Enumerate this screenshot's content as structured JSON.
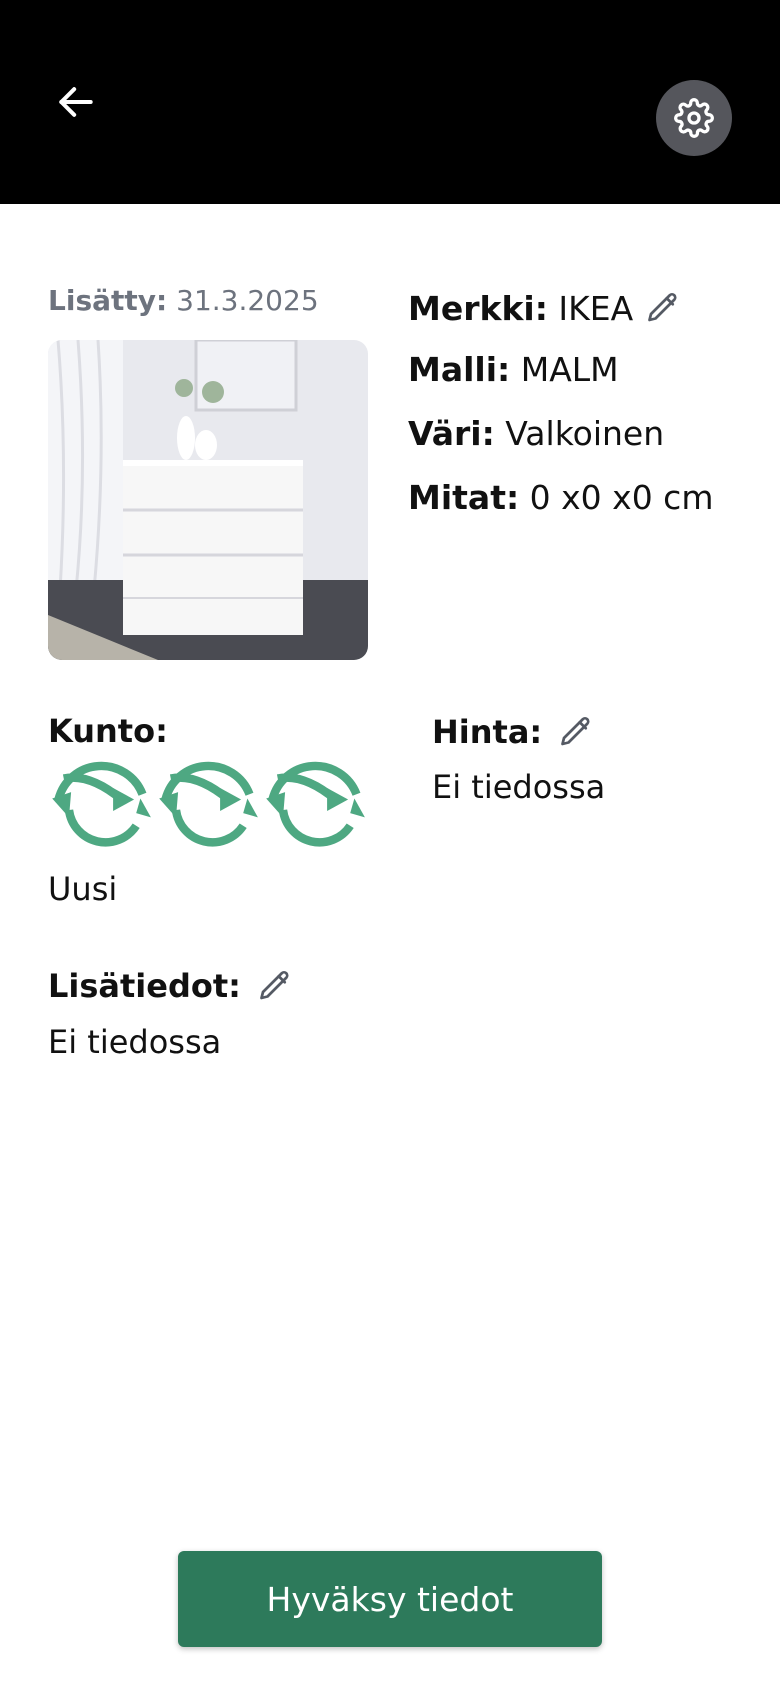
{
  "header": {
    "back_icon": "arrow-left-icon",
    "settings_icon": "gear-icon"
  },
  "added": {
    "label": "Lisätty:",
    "date": "31.3.2025"
  },
  "specs": {
    "brand_label": "Merkki:",
    "brand_value": "IKEA",
    "model_label": "Malli:",
    "model_value": "MALM",
    "color_label": "Väri:",
    "color_value": "Valkoinen",
    "dims_label": "Mitat:",
    "dims_value": "0 x0 x0 cm"
  },
  "condition": {
    "label": "Kunto:",
    "rating": 3,
    "max": 3,
    "value": "Uusi",
    "icon_color": "#4ea882"
  },
  "price": {
    "label": "Hinta:",
    "value": "Ei tiedossa"
  },
  "extra": {
    "label": "Lisätiedot:",
    "value": "Ei tiedossa"
  },
  "actions": {
    "accept_label": "Hyväksy tiedot",
    "accent": "#2d7a5b"
  }
}
